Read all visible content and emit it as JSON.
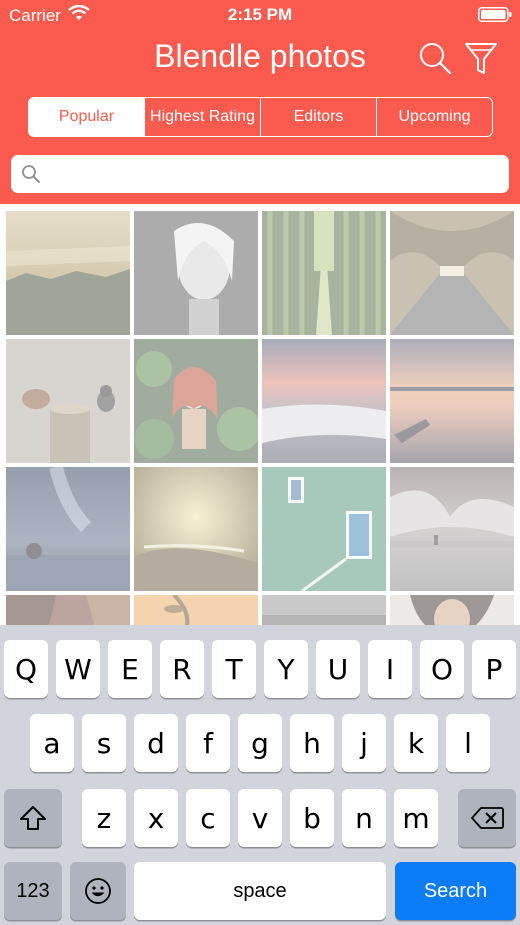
{
  "status_bar": {
    "carrier": "Carrier",
    "time": "2:15 PM"
  },
  "header": {
    "title": "Blendle photos",
    "icons": [
      "search-icon",
      "filter-icon"
    ]
  },
  "segments": [
    {
      "label": "Popular",
      "active": true
    },
    {
      "label": "Highest Rating",
      "active": false
    },
    {
      "label": "Editors",
      "active": false
    },
    {
      "label": "Upcoming",
      "active": false
    }
  ],
  "search": {
    "value": "",
    "placeholder": ""
  },
  "colors": {
    "accent": "#fb5a4e",
    "search_key": "#0b7cf7"
  },
  "photos": [
    {
      "subject": "misty-forest-lake"
    },
    {
      "subject": "woman-portrait-bw"
    },
    {
      "subject": "bamboo-forest-path"
    },
    {
      "subject": "tree-tunnel-road"
    },
    {
      "subject": "birds-on-stump"
    },
    {
      "subject": "red-haired-woman-leaves"
    },
    {
      "subject": "pink-sunset-waterfall"
    },
    {
      "subject": "lake-with-boat"
    },
    {
      "subject": "milky-way-lake"
    },
    {
      "subject": "golden-river-sunrise"
    },
    {
      "subject": "green-wall-door"
    },
    {
      "subject": "misty-sea-rock"
    },
    {
      "subject": "brown-hair"
    },
    {
      "subject": "orange-sky-leaves"
    },
    {
      "subject": "gray-sky"
    },
    {
      "subject": "curly-hair-woman"
    }
  ],
  "keyboard": {
    "row1": [
      "Q",
      "W",
      "E",
      "R",
      "T",
      "Y",
      "U",
      "I",
      "O",
      "P"
    ],
    "row2": [
      "a",
      "s",
      "d",
      "f",
      "g",
      "h",
      "j",
      "k",
      "l"
    ],
    "row3": [
      "z",
      "x",
      "c",
      "v",
      "b",
      "n",
      "m"
    ],
    "numbers_label": "123",
    "space_label": "space",
    "search_label": "Search"
  }
}
